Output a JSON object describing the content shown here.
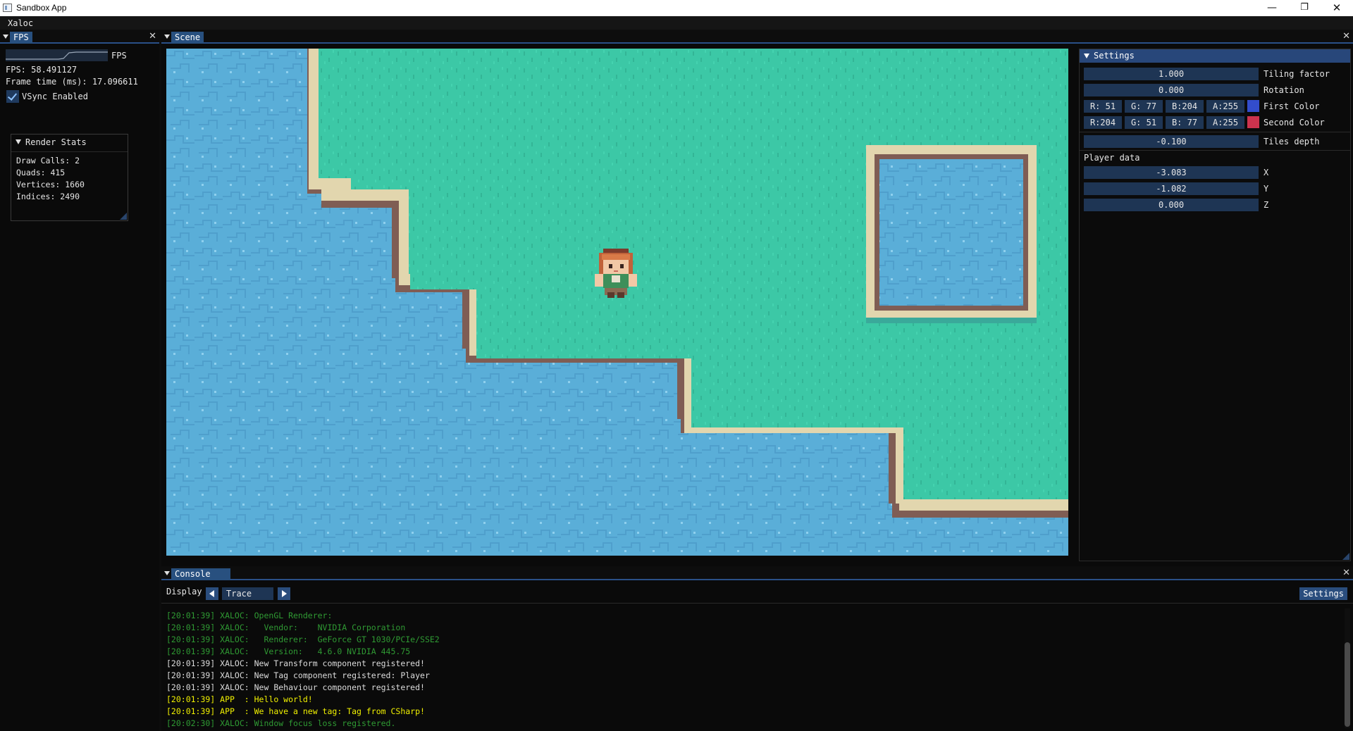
{
  "window": {
    "title": "Sandbox App",
    "minimize": "—",
    "maximize": "❐",
    "close": "✕"
  },
  "menubar": {
    "items": [
      "Xaloc"
    ]
  },
  "fps_panel": {
    "tab": "FPS",
    "plot_label": "FPS",
    "fps_text": "FPS: 58.491127",
    "frame_time_text": "Frame time (ms): 17.096611",
    "vsync_label": "VSync Enabled",
    "vsync_checked": true,
    "render_stats": {
      "title": "Render Stats",
      "draw_calls": "Draw Calls: 2",
      "quads": "Quads: 415",
      "vertices": "Vertices: 1660",
      "indices": "Indices: 2490"
    }
  },
  "scene_panel": {
    "tab": "Scene",
    "close": "✕"
  },
  "settings": {
    "title": "Settings",
    "tiling_factor": {
      "value": "1.000",
      "label": "Tiling factor"
    },
    "rotation": {
      "value": "0.000",
      "label": "Rotation"
    },
    "first_color": {
      "r": "R: 51",
      "g": "G: 77",
      "b": "B:204",
      "a": "A:255",
      "label": "First Color",
      "hex": "#334dcc"
    },
    "second_color": {
      "r": "R:204",
      "g": "G: 51",
      "b": "B: 77",
      "a": "A:255",
      "label": "Second Color",
      "hex": "#cc334d"
    },
    "tiles_depth": {
      "value": "-0.100",
      "label": "Tiles depth"
    },
    "player_heading": "Player data",
    "player": {
      "x": {
        "value": "-3.083",
        "label": "X"
      },
      "y": {
        "value": "-1.082",
        "label": "Y"
      },
      "z": {
        "value": "0.000",
        "label": "Z"
      }
    }
  },
  "console": {
    "tab": "Console",
    "close": "✕",
    "display_label": "Display",
    "level": "Trace",
    "settings_button": "Settings",
    "lines": [
      {
        "text": "[20:01:39] XALOC: OpenGL Renderer:",
        "color": "green"
      },
      {
        "text": "[20:01:39] XALOC:   Vendor:    NVIDIA Corporation",
        "color": "green"
      },
      {
        "text": "[20:01:39] XALOC:   Renderer:  GeForce GT 1030/PCIe/SSE2",
        "color": "green"
      },
      {
        "text": "[20:01:39] XALOC:   Version:   4.6.0 NVIDIA 445.75",
        "color": "green"
      },
      {
        "text": "[20:01:39] XALOC: New Transform component registered!",
        "color": "white"
      },
      {
        "text": "[20:01:39] XALOC: New Tag component registered: Player",
        "color": "white"
      },
      {
        "text": "[20:01:39] XALOC: New Behaviour component registered!",
        "color": "white"
      },
      {
        "text": "[20:01:39] APP  : Hello world!",
        "color": "yellow"
      },
      {
        "text": "[20:01:39] APP  : We have a new tag: Tag from CSharp!",
        "color": "yellow"
      },
      {
        "text": "[20:02:30] XALOC: Window focus loss registered.",
        "color": "green"
      }
    ]
  },
  "colors": {
    "water": "#5aaed8",
    "grass": "#3cc8a6",
    "sand": "#e2d6ae",
    "dirt": "#7f5d54",
    "accent": "#28507f"
  }
}
